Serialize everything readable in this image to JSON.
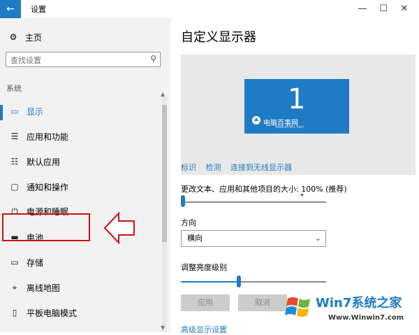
{
  "window": {
    "title": "设置"
  },
  "sidebar": {
    "home_label": "主页",
    "search_placeholder": "查找设置",
    "section_label": "系统",
    "items": [
      {
        "label": "显示",
        "icon": "display-icon"
      },
      {
        "label": "应用和功能",
        "icon": "apps-list-icon"
      },
      {
        "label": "默认应用",
        "icon": "default-apps-icon"
      },
      {
        "label": "通知和操作",
        "icon": "notification-icon"
      },
      {
        "label": "电源和睡眠",
        "icon": "power-icon"
      },
      {
        "label": "电池",
        "icon": "battery-icon"
      },
      {
        "label": "存储",
        "icon": "storage-icon"
      },
      {
        "label": "离线地图",
        "icon": "map-icon"
      },
      {
        "label": "平板电脑模式",
        "icon": "tablet-icon"
      }
    ],
    "selected_index": 0,
    "highlighted_index": 4
  },
  "main": {
    "title": "自定义显示器",
    "monitor_number": "1",
    "monitor_brand": "电脑百事网",
    "monitor_brand_url": "www.pc841.com",
    "links": [
      "标识",
      "检测",
      "连接到无线显示器"
    ],
    "scale_label": "更改文本、应用和其他项目的大小: 100% (推荐)",
    "scale_slider_value": 0,
    "orientation_label": "方向",
    "orientation_value": "横向",
    "brightness_label": "调整亮度级别",
    "brightness_value": 0.4,
    "apply_label": "应用",
    "cancel_label": "取消",
    "advanced_link": "高级显示设置"
  },
  "watermark": {
    "title": "Win7系统之家",
    "url": "Www.Winwin7.com"
  },
  "colors": {
    "accent": "#1f7bc4",
    "highlight": "#cc1111"
  }
}
